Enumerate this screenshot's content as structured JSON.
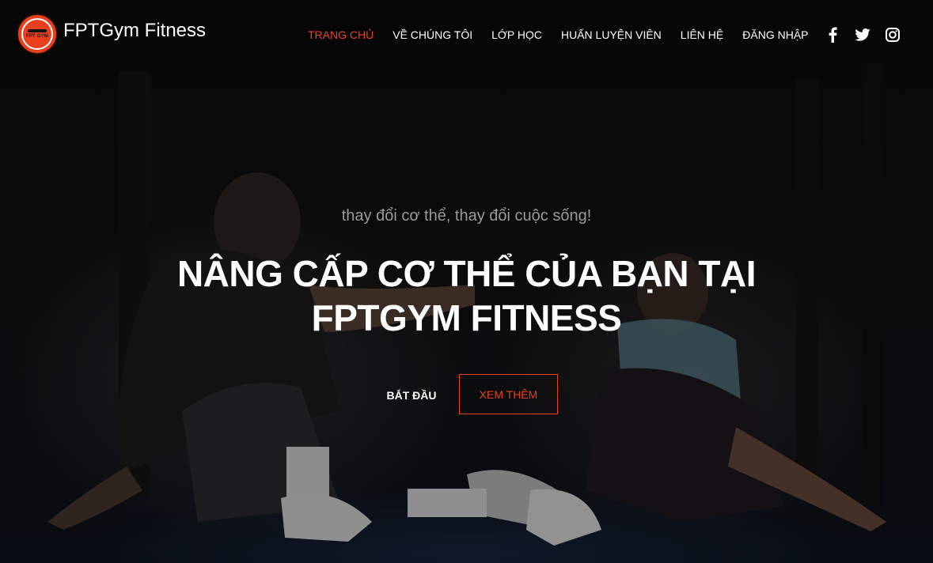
{
  "header": {
    "brand": "FPTGym Fitness",
    "logo_text": "FPT GYM"
  },
  "nav": {
    "items": [
      {
        "label": "TRANG CHỦ",
        "active": true
      },
      {
        "label": "VỀ CHÚNG TÔI",
        "active": false
      },
      {
        "label": "LỚP HỌC",
        "active": false
      },
      {
        "label": "HUẤN LUYỆN VIÊN",
        "active": false
      },
      {
        "label": "LIÊN HỆ",
        "active": false
      },
      {
        "label": "ĐĂNG NHẬP",
        "active": false
      }
    ]
  },
  "social": [
    "facebook-icon",
    "twitter-icon",
    "instagram-icon"
  ],
  "hero": {
    "tagline": "thay đổi cơ thể, thay đổi cuộc sống!",
    "headline_line1": "NÂNG CẤP CƠ THỂ CỦA BẠN TẠI",
    "headline_line2": "FPTGYM FITNESS",
    "primary_button": "BẮT ĐẦU",
    "secondary_button": "XEM THÊM"
  },
  "colors": {
    "accent": "#e8401c",
    "background": "#0b0b0b",
    "text": "#ffffff",
    "muted": "#9a9a9a"
  }
}
